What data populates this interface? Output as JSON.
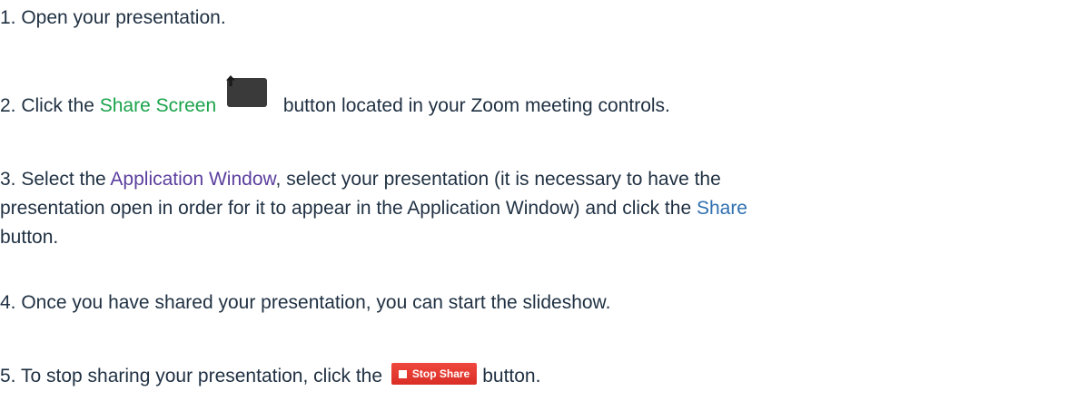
{
  "steps": [
    {
      "text": "1. Open your presentation."
    },
    {
      "prefix": "2. Click the ",
      "highlight": "Share Screen",
      "suffix": " button located in your Zoom meeting controls."
    },
    {
      "line1_prefix": "3. Select the ",
      "line1_highlight": "Application Window",
      "line1_suffix": ", select your presentation (it is necessary to have the",
      "line2": "presentation open in order for it to appear in the Application Window) and click the ",
      "line2_highlight": "Share",
      "line3": "button."
    },
    {
      "text": "4. Once you have shared your presentation, you can start the slideshow."
    },
    {
      "prefix": "5. To stop sharing your presentation, click the ",
      "button_label": "Stop Share",
      "suffix": "button."
    }
  ],
  "icons": {
    "share_screen": "share-screen-arrow-up-icon",
    "stop_share": "stop-square-icon"
  },
  "colors": {
    "text": "#1f3042",
    "share_screen_highlight": "#1aa34a",
    "application_window_highlight": "#5b3e9e",
    "share_highlight": "#2f6fb0",
    "share_icon_green": "#35d04b",
    "stop_share_red": "#e0342b"
  }
}
